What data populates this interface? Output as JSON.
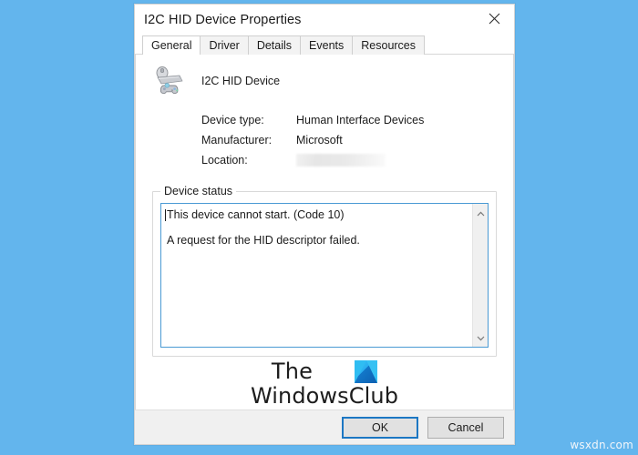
{
  "desktop": {
    "background_color": "#63b5ed",
    "corner_watermark": "wsxdn.com"
  },
  "dialog": {
    "title": "I2C HID Device Properties",
    "close_icon": "close-icon",
    "tabs": [
      {
        "label": "General",
        "selected": true
      },
      {
        "label": "Driver",
        "selected": false
      },
      {
        "label": "Details",
        "selected": false
      },
      {
        "label": "Events",
        "selected": false
      },
      {
        "label": "Resources",
        "selected": false
      }
    ],
    "general": {
      "device_icon": "hid-device-icon",
      "device_name": "I2C HID Device",
      "properties": [
        {
          "label": "Device type:",
          "value": "Human Interface Devices",
          "redacted": false
        },
        {
          "label": "Manufacturer:",
          "value": "Microsoft",
          "redacted": false
        },
        {
          "label": "Location:",
          "value": "",
          "redacted": true
        }
      ],
      "device_status": {
        "legend": "Device status",
        "lines": [
          "This device cannot start. (Code 10)",
          "A request for the HID descriptor failed."
        ],
        "scroll_up_icon": "chevron-up-icon",
        "scroll_down_icon": "chevron-down-icon",
        "focus_border_color": "#4a9ad4"
      }
    },
    "watermark": {
      "line1": "The",
      "line2": "WindowsClub",
      "logo_icon": "windowsclub-logo-icon",
      "logo_color": "#1b8ce0"
    },
    "footer": {
      "ok_label": "OK",
      "cancel_label": "Cancel",
      "default_button_color": "#1c77c3"
    }
  }
}
